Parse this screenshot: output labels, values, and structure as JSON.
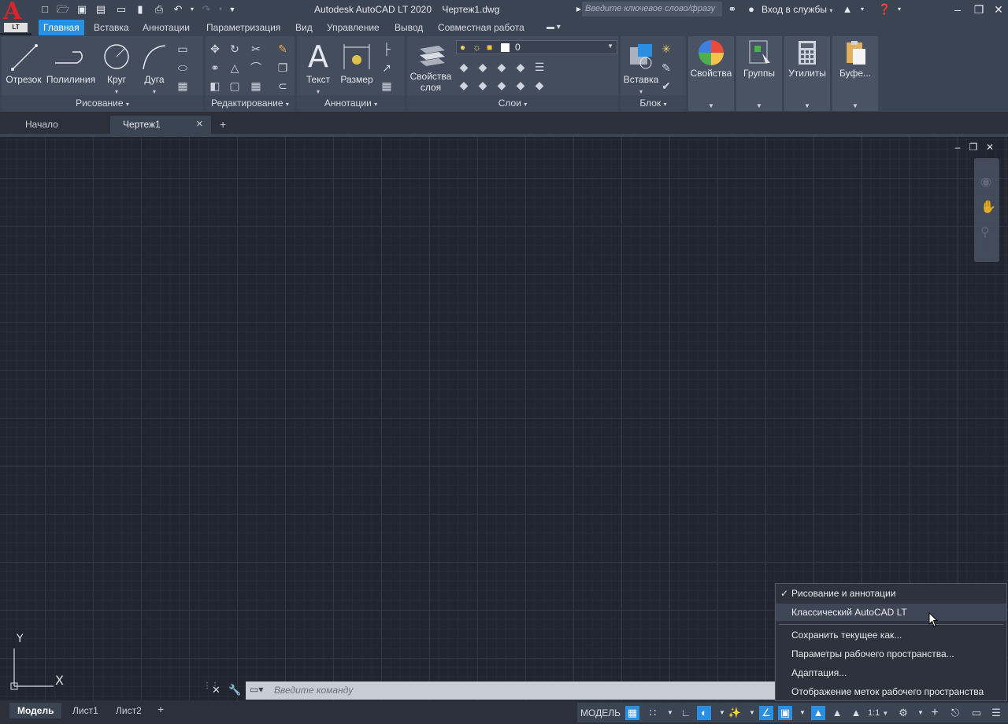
{
  "app": {
    "logo_letter": "A",
    "logo_badge": "LT",
    "title": "Autodesk AutoCAD LT 2020",
    "filename": "Чертеж1.dwg"
  },
  "titlebar": {
    "search_placeholder": "Введите ключевое слово/фразу",
    "signin_label": "Вход в службы"
  },
  "ribbon_tabs": [
    {
      "label": "Главная",
      "active": true
    },
    {
      "label": "Вставка"
    },
    {
      "label": "Аннотации"
    },
    {
      "label": "Параметризация"
    },
    {
      "label": "Вид"
    },
    {
      "label": "Управление"
    },
    {
      "label": "Вывод"
    },
    {
      "label": "Совместная работа"
    }
  ],
  "ribbon": {
    "draw": {
      "title": "Рисование",
      "line": "Отрезок",
      "polyline": "Полилиния",
      "circle": "Круг",
      "arc": "Дуга"
    },
    "modify": {
      "title": "Редактирование"
    },
    "annotation": {
      "title": "Аннотации",
      "text": "Текст",
      "dimension": "Размер"
    },
    "layers": {
      "title": "Слои",
      "layer_props_line1": "Свойства",
      "layer_props_line2": "слоя",
      "current_layer": "0"
    },
    "block": {
      "title": "Блок",
      "insert": "Вставка"
    },
    "properties": {
      "label": "Свойства"
    },
    "groups": {
      "label": "Группы"
    },
    "utilities": {
      "label": "Утилиты"
    },
    "clipboard": {
      "label": "Буфе..."
    }
  },
  "doc_tabs": [
    {
      "label": "Начало"
    },
    {
      "label": "Чертеж1",
      "active": true
    }
  ],
  "ucs": {
    "x_label": "X",
    "y_label": "Y"
  },
  "command_line": {
    "placeholder": "Введите команду"
  },
  "layout_tabs": [
    {
      "label": "Модель",
      "active": true
    },
    {
      "label": "Лист1"
    },
    {
      "label": "Лист2"
    }
  ],
  "status": {
    "model_label": "МОДЕЛЬ",
    "scale_label": "1:1"
  },
  "workspace_menu": {
    "items": [
      {
        "label": "Рисование и аннотации",
        "checked": true
      },
      {
        "label": "Классический AutoCAD LT",
        "hover": true
      },
      {
        "label": "Сохранить текущее как..."
      },
      {
        "label": "Параметры рабочего пространства..."
      },
      {
        "label": "Адаптация..."
      },
      {
        "label": "Отображение меток рабочего пространства"
      }
    ]
  },
  "colors": {
    "accent": "#2a8fe0",
    "logo_red": "#d6252d",
    "canvas": "#212530",
    "ribbon": "#3b4453"
  }
}
